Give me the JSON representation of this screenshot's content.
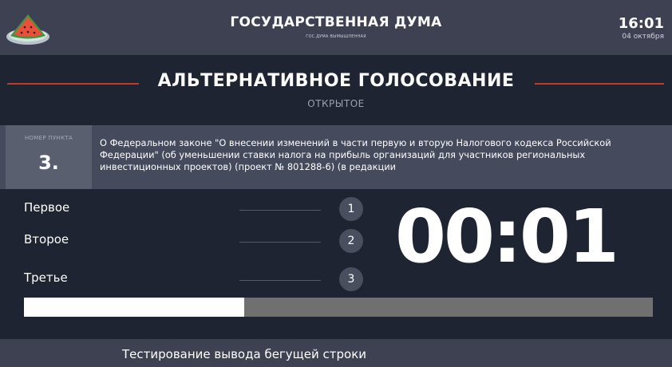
{
  "header": {
    "title": "ГОСУДАРСТВЕННАЯ ДУМА",
    "subtitle": "ГОС.ДУМА ВЫМЫШЛЕННАЯ",
    "time": "16:01",
    "date": "04 октября",
    "logo_icon": "watermelon-icon"
  },
  "vote": {
    "title": "АЛЬТЕРНАТИВНОЕ ГОЛОСОВАНИЕ",
    "mode": "ОТКРЫТОЕ",
    "rule_color": "#c0392b"
  },
  "item": {
    "number_label": "НОМЕР ПУНКТА",
    "number": "3.",
    "text": "О Федеральном законе \"О внесении изменений в части первую и вторую Налогового кодекса Российской Федерации\" (об уменьшении ставки налога на прибыль организаций для участников региональных инвестиционных проектов) (проект № 801288-6) (в редакции"
  },
  "readings": [
    {
      "label": "Первое",
      "badge": "1"
    },
    {
      "label": "Второе",
      "badge": "2"
    },
    {
      "label": "Третье",
      "badge": "3"
    }
  ],
  "timer": "00:01",
  "progress": {
    "fraction": 0.35
  },
  "ticker": {
    "text": "Тестирование вывода бегущей строки"
  },
  "colors": {
    "background": "#1e2431",
    "header": "#3d4152",
    "item_row": "#454a5c",
    "accent": "#c0392b"
  }
}
